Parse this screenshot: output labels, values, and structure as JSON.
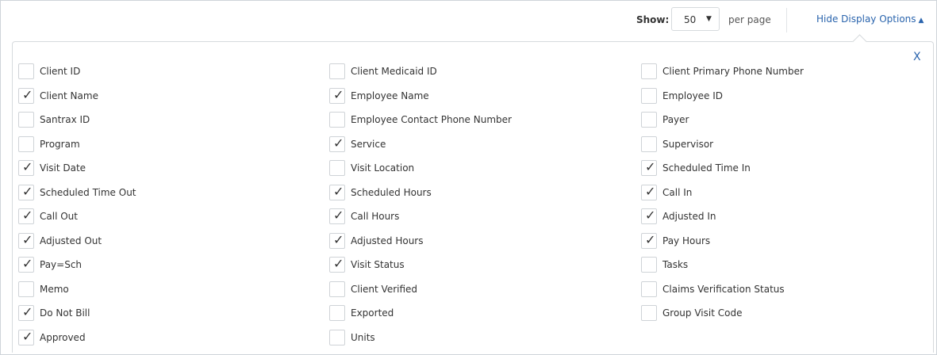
{
  "toolbar": {
    "show_label": "Show:",
    "page_size_value": "50",
    "per_page_label": "per page",
    "hide_options_label": "Hide Display Options"
  },
  "panel": {
    "close_label": "X",
    "columns": [
      [
        {
          "label": "Client ID",
          "checked": false
        },
        {
          "label": "Client Name",
          "checked": true
        },
        {
          "label": "Santrax ID",
          "checked": false
        },
        {
          "label": "Program",
          "checked": false
        },
        {
          "label": "Visit Date",
          "checked": true
        },
        {
          "label": "Scheduled Time Out",
          "checked": true
        },
        {
          "label": "Call Out",
          "checked": true
        },
        {
          "label": "Adjusted Out",
          "checked": true
        },
        {
          "label": "Pay=Sch",
          "checked": true
        },
        {
          "label": "Memo",
          "checked": false
        },
        {
          "label": "Do Not Bill",
          "checked": true
        },
        {
          "label": "Approved",
          "checked": true
        }
      ],
      [
        {
          "label": "Client Medicaid ID",
          "checked": false
        },
        {
          "label": "Employee Name",
          "checked": true
        },
        {
          "label": "Employee Contact Phone Number",
          "checked": false
        },
        {
          "label": "Service",
          "checked": true
        },
        {
          "label": "Visit Location",
          "checked": false
        },
        {
          "label": "Scheduled Hours",
          "checked": true
        },
        {
          "label": "Call Hours",
          "checked": true
        },
        {
          "label": "Adjusted Hours",
          "checked": true
        },
        {
          "label": "Visit Status",
          "checked": true
        },
        {
          "label": "Client Verified",
          "checked": false
        },
        {
          "label": "Exported",
          "checked": false
        },
        {
          "label": "Units",
          "checked": false
        }
      ],
      [
        {
          "label": "Client Primary Phone Number",
          "checked": false
        },
        {
          "label": "Employee ID",
          "checked": false
        },
        {
          "label": "Payer",
          "checked": false
        },
        {
          "label": "Supervisor",
          "checked": false
        },
        {
          "label": "Scheduled Time In",
          "checked": true
        },
        {
          "label": "Call In",
          "checked": true
        },
        {
          "label": "Adjusted In",
          "checked": true
        },
        {
          "label": "Pay Hours",
          "checked": true
        },
        {
          "label": "Tasks",
          "checked": false
        },
        {
          "label": "Claims Verification Status",
          "checked": false
        },
        {
          "label": "Group Visit Code",
          "checked": false
        }
      ]
    ]
  },
  "colors": {
    "link": "#2a64ad",
    "border": "#d6dadd",
    "text": "#333333"
  }
}
